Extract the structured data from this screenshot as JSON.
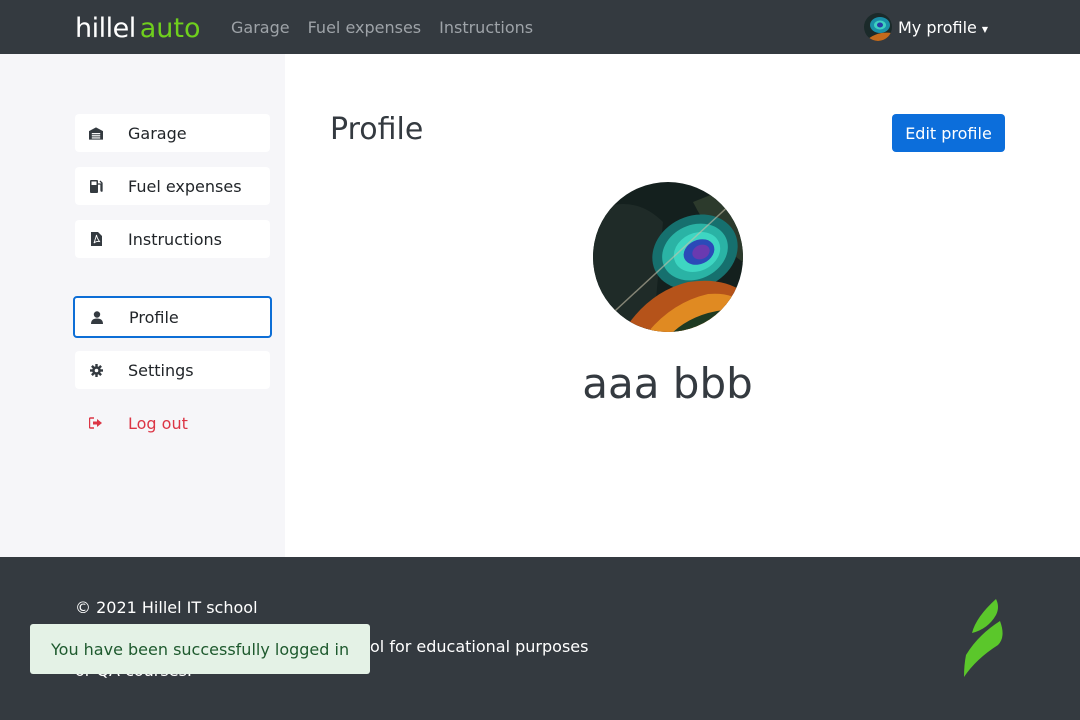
{
  "header": {
    "logo_main": "hillel",
    "logo_accent": "auto",
    "nav": [
      "Garage",
      "Fuel expenses",
      "Instructions"
    ],
    "profile_label": "My profile",
    "caret_icon": "caret-down-icon"
  },
  "sidebar": {
    "items": [
      {
        "label": "Garage",
        "icon": "garage-icon"
      },
      {
        "label": "Fuel expenses",
        "icon": "fuel-pump-icon"
      },
      {
        "label": "Instructions",
        "icon": "pdf-file-icon"
      },
      {
        "label": "Profile",
        "icon": "user-icon",
        "active": true
      },
      {
        "label": "Settings",
        "icon": "gear-icon"
      },
      {
        "label": "Log out",
        "icon": "sign-out-icon"
      }
    ]
  },
  "main": {
    "title": "Profile",
    "edit_button": "Edit profile",
    "user_name": "aaa bbb"
  },
  "footer": {
    "copyright": "© 2021 Hillel IT school",
    "line2_visible": "ol for educational purposes",
    "line3_visible": "or QA courses."
  },
  "toast": {
    "message": "You have been successfully logged in"
  },
  "colors": {
    "header_bg": "#343a40",
    "accent_blue": "#0c6edb",
    "logo_green": "#6fcf1d",
    "logout_red": "#dc3545",
    "toast_bg": "#e4f2e6"
  }
}
